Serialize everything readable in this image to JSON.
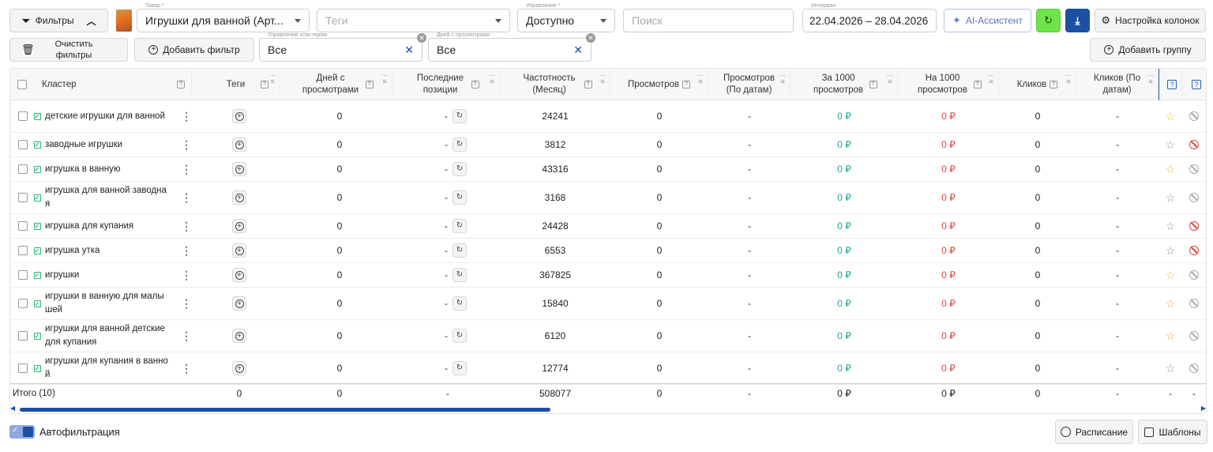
{
  "toolbar": {
    "filters_label": "Фильтры",
    "product_label": "Товар *",
    "product_value": "Игрушки для ванной (Арт...",
    "tags_placeholder": "Теги",
    "management_label": "Управление *",
    "management_value": "Доступно",
    "search_placeholder": "Поиск",
    "interval_label": "Интервал",
    "interval_value": "22.04.2026 – 28.04.2026",
    "ai_label": "AI-Ассистент",
    "columns_label": "Настройка колонок",
    "clear_label": "Очистить фильтры",
    "add_filter_label": "Добавить фильтр",
    "cluster_mgmt_label": "Управление кластером",
    "cluster_mgmt_value": "Все",
    "days_label": "Дней с просмотрами",
    "days_value": "Все",
    "add_group_label": "Добавить группу"
  },
  "headers": {
    "cluster": "Кластер",
    "tags": "Теги",
    "days": "Дней с просмотрами",
    "last_pos": "Последние позиции",
    "freq": "Частотность (Месяц)",
    "views": "Просмотров",
    "views_dates": "Просмотров (По датам)",
    "per1000": "За 1000 просмотров",
    "on1000": "На 1000 просмотров",
    "clicks": "Кликов",
    "clicks_dates": "Кликов (По датам)"
  },
  "rows": [
    {
      "name": "детские игрушки для ванной",
      "days": "0",
      "last": "-",
      "freq": "24241",
      "views": "0",
      "vd": "-",
      "p1000": "0 ₽",
      "n1000": "0 ₽",
      "clicks": "0",
      "cd": "-",
      "star": true,
      "ban": false
    },
    {
      "name": "заводные игрушки",
      "days": "0",
      "last": "-",
      "freq": "3812",
      "views": "0",
      "vd": "-",
      "p1000": "0 ₽",
      "n1000": "0 ₽",
      "clicks": "0",
      "cd": "-",
      "star": false,
      "ban": true
    },
    {
      "name": "игрушка в ванную",
      "days": "0",
      "last": "-",
      "freq": "43316",
      "views": "0",
      "vd": "-",
      "p1000": "0 ₽",
      "n1000": "0 ₽",
      "clicks": "0",
      "cd": "-",
      "star": true,
      "ban": false
    },
    {
      "name": "игрушка для ванной заводная",
      "days": "0",
      "last": "-",
      "freq": "3168",
      "views": "0",
      "vd": "-",
      "p1000": "0 ₽",
      "n1000": "0 ₽",
      "clicks": "0",
      "cd": "-",
      "star": false,
      "ban": false
    },
    {
      "name": "игрушка для купания",
      "days": "0",
      "last": "-",
      "freq": "24428",
      "views": "0",
      "vd": "-",
      "p1000": "0 ₽",
      "n1000": "0 ₽",
      "clicks": "0",
      "cd": "-",
      "star": false,
      "ban": true
    },
    {
      "name": "игрушка утка",
      "days": "0",
      "last": "-",
      "freq": "6553",
      "views": "0",
      "vd": "-",
      "p1000": "0 ₽",
      "n1000": "0 ₽",
      "clicks": "0",
      "cd": "-",
      "star": false,
      "ban": true
    },
    {
      "name": "игрушки",
      "days": "0",
      "last": "-",
      "freq": "367825",
      "views": "0",
      "vd": "-",
      "p1000": "0 ₽",
      "n1000": "0 ₽",
      "clicks": "0",
      "cd": "-",
      "star": true,
      "ban": false
    },
    {
      "name": "игрушки в ванную для малышей",
      "days": "0",
      "last": "-",
      "freq": "15840",
      "views": "0",
      "vd": "-",
      "p1000": "0 ₽",
      "n1000": "0 ₽",
      "clicks": "0",
      "cd": "-",
      "star": true,
      "ban": false
    },
    {
      "name": "игрушки для ванной детские для купания",
      "days": "0",
      "last": "-",
      "freq": "6120",
      "views": "0",
      "vd": "-",
      "p1000": "0 ₽",
      "n1000": "0 ₽",
      "clicks": "0",
      "cd": "-",
      "star": true,
      "ban": false
    },
    {
      "name": "игрушки для купания в ванной",
      "days": "0",
      "last": "-",
      "freq": "12774",
      "views": "0",
      "vd": "-",
      "p1000": "0 ₽",
      "n1000": "0 ₽",
      "clicks": "0",
      "cd": "-",
      "star": false,
      "ban": false
    }
  ],
  "totals": {
    "label": "Итого (10)",
    "tags": "0",
    "days": "0",
    "last": "-",
    "freq": "508077",
    "views": "0",
    "vd": "-",
    "p1000": "0 ₽",
    "n1000": "0 ₽",
    "clicks": "0",
    "cd": "-",
    "x1": "-",
    "x2": "-"
  },
  "footer": {
    "autofilter_label": "Автофильтрация",
    "autofilter_on": true,
    "schedule_label": "Расписание",
    "templates_label": "Шаблоны"
  },
  "colors": {
    "accent": "#1d4fa3",
    "green": "#19a99a",
    "red": "#e0443d",
    "star": "#f2b233"
  },
  "icons": {
    "filter": "filter-icon",
    "trash": "trash-icon",
    "sparkle": "sparkle-icon",
    "refresh": "refresh-icon",
    "download": "download-icon",
    "gear": "gear-icon",
    "clock": "clock-icon",
    "template": "template-icon"
  }
}
